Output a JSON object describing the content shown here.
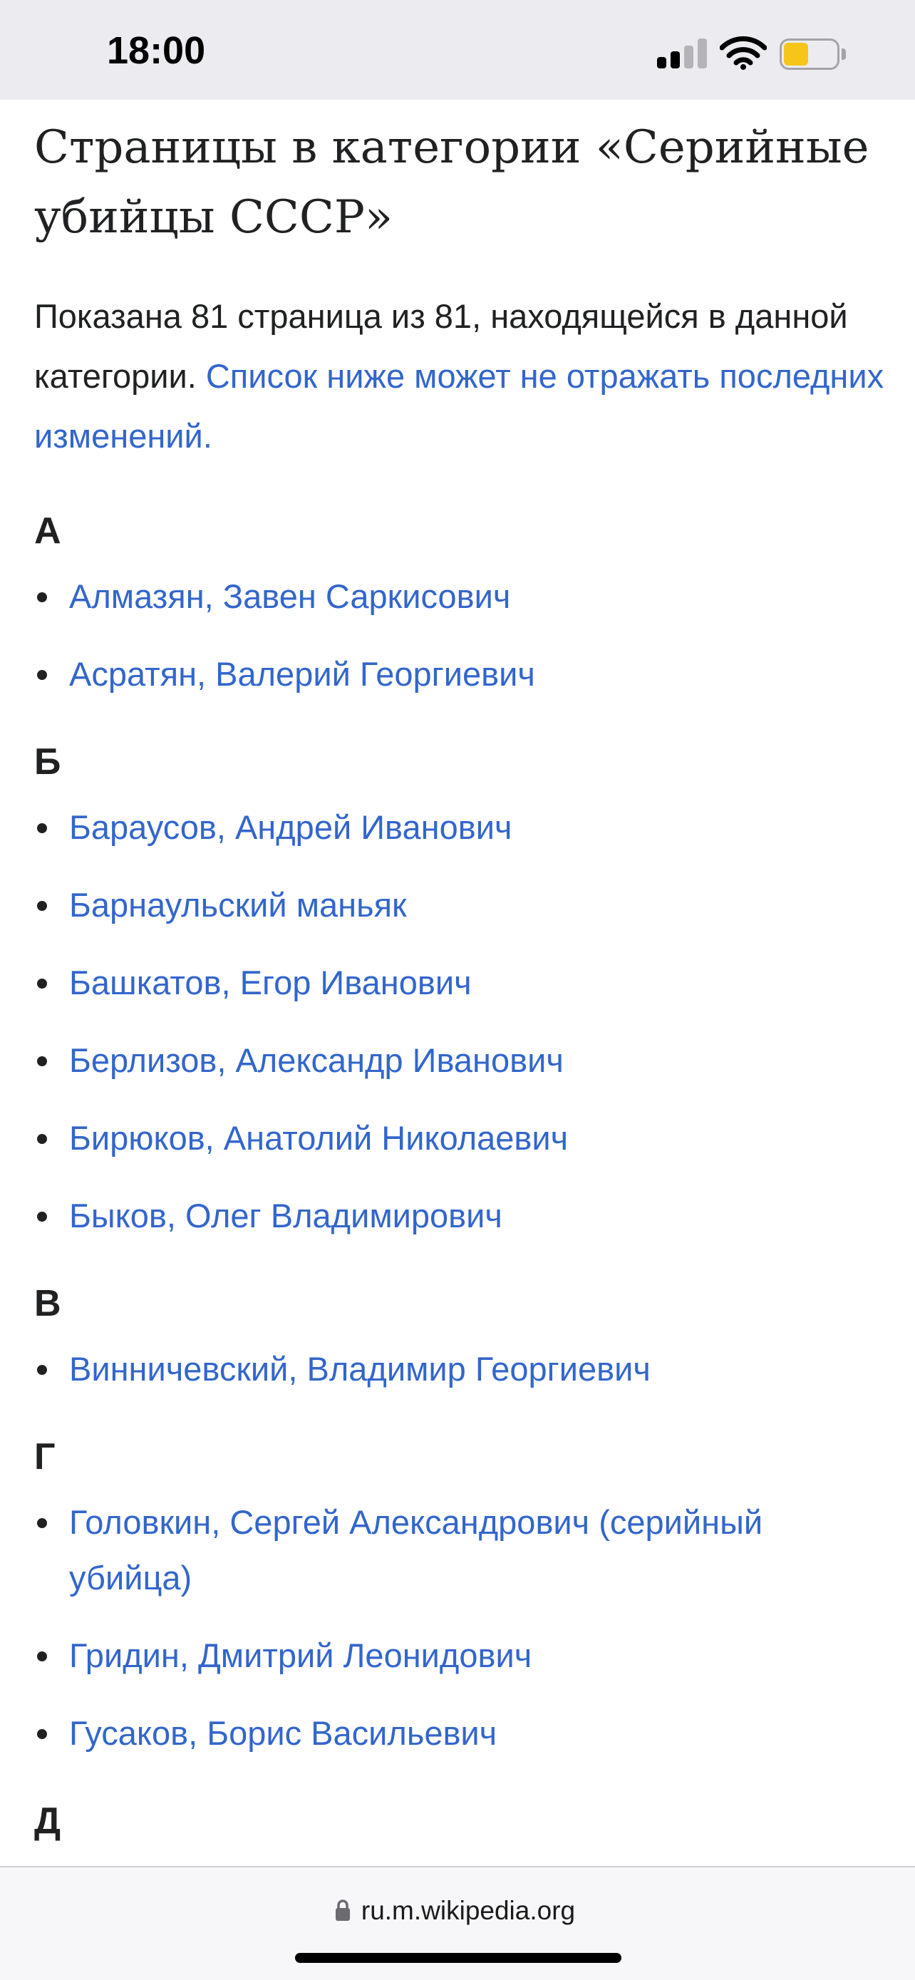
{
  "status": {
    "time": "18:00",
    "battery_color": "#f5c518"
  },
  "page": {
    "title": "Страницы в категории «Серийные убийцы СССР»",
    "intro_text": "Показана 81 страница из 81, находящейся в данной категории. ",
    "intro_link": "Список ниже может не отражать последних изменений."
  },
  "groups": [
    {
      "letter": "А",
      "items": [
        "Алмазян, Завен Саркисович",
        "Асратян, Валерий Георгиевич"
      ]
    },
    {
      "letter": "Б",
      "items": [
        "Бараусов, Андрей Иванович",
        "Барнаульский маньяк",
        "Башкатов, Егор Иванович",
        "Берлизов, Александр Иванович",
        "Бирюков, Анатолий Николаевич",
        "Быков, Олег Владимирович"
      ]
    },
    {
      "letter": "В",
      "items": [
        "Винничевский, Владимир Георгиевич"
      ]
    },
    {
      "letter": "Г",
      "items": [
        "Головкин, Сергей Александрович (серийный убийца)",
        "Гридин, Дмитрий Леонидович",
        "Гусаков, Борис Васильевич"
      ]
    },
    {
      "letter": "Д",
      "items": []
    }
  ],
  "browser": {
    "url": "ru.m.wikipedia.org",
    "lock_icon": "lock-icon"
  },
  "colors": {
    "link": "#3366cc",
    "text": "#202122",
    "status_bar_bg": "#ececf0"
  }
}
